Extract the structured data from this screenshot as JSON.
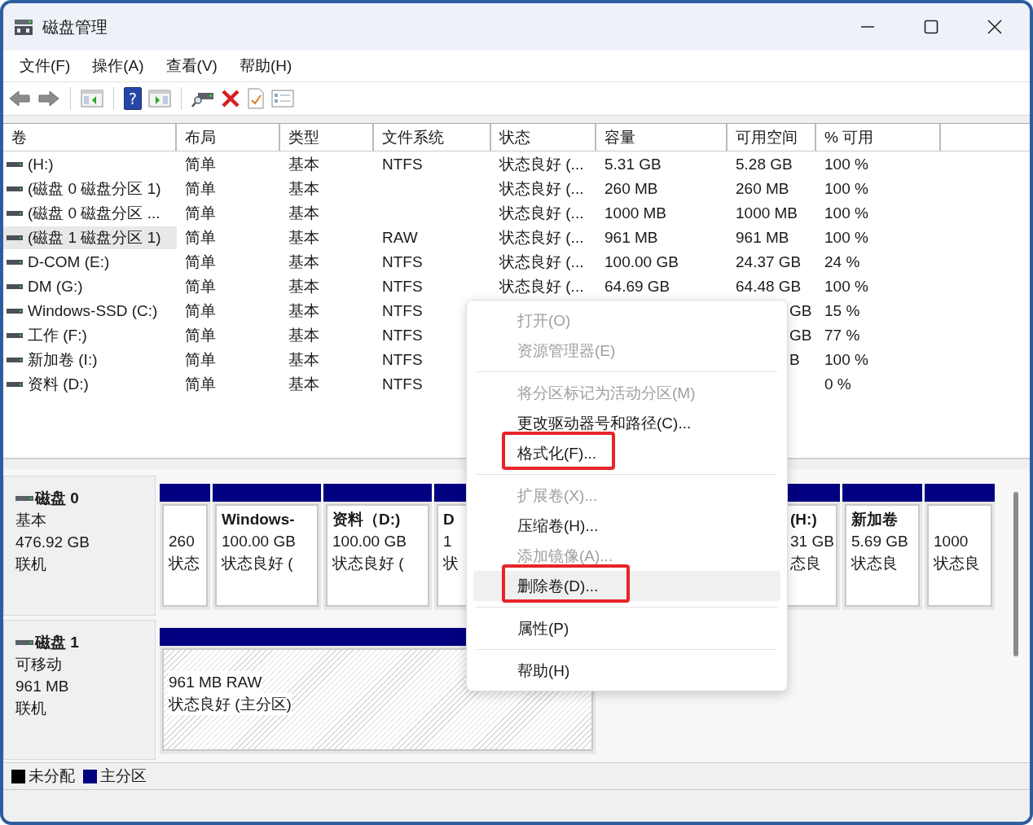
{
  "window": {
    "title": "磁盘管理"
  },
  "menu_bar": [
    "文件(F)",
    "操作(A)",
    "查看(V)",
    "帮助(H)"
  ],
  "toolbar": {
    "help_glyph": "?"
  },
  "table": {
    "columns": [
      "卷",
      "布局",
      "类型",
      "文件系统",
      "状态",
      "容量",
      "可用空间",
      "% 可用"
    ],
    "rows": [
      {
        "selected": false,
        "covered": false,
        "cells": {
          "volume": "(H:)",
          "layout": "简单",
          "type": "基本",
          "fs": "NTFS",
          "status": "状态良好 (...",
          "capacity": "5.31 GB",
          "free": "5.28 GB",
          "pct": "100 %"
        }
      },
      {
        "selected": false,
        "covered": false,
        "cells": {
          "volume": "(磁盘 0 磁盘分区 1)",
          "layout": "简单",
          "type": "基本",
          "status": "状态良好 (...",
          "capacity": "260 MB",
          "free": "260 MB",
          "pct": "100 %"
        }
      },
      {
        "selected": false,
        "covered": false,
        "cells": {
          "volume": "(磁盘 0 磁盘分区 ...",
          "layout": "简单",
          "type": "基本",
          "status": "状态良好 (...",
          "capacity": "1000 MB",
          "free": "1000 MB",
          "pct": "100 %"
        }
      },
      {
        "selected": true,
        "covered": false,
        "cells": {
          "volume": "(磁盘 1 磁盘分区 1)",
          "layout": "简单",
          "type": "基本",
          "fs": "RAW",
          "status": "状态良好 (...",
          "capacity": "961 MB",
          "free": "961 MB",
          "pct": "100 %"
        }
      },
      {
        "selected": false,
        "covered": false,
        "cells": {
          "volume": "D-COM (E:)",
          "layout": "简单",
          "type": "基本",
          "fs": "NTFS",
          "status": "状态良好 (...",
          "capacity": "100.00 GB",
          "free": "24.37 GB",
          "pct": "24 %"
        }
      },
      {
        "selected": false,
        "covered": false,
        "cells": {
          "volume": "DM (G:)",
          "layout": "简单",
          "type": "基本",
          "fs": "NTFS",
          "status": "状态良好 (...",
          "capacity": "64.69 GB",
          "free": "64.48 GB",
          "pct": "100 %"
        }
      },
      {
        "selected": false,
        "covered": true,
        "cells": {
          "volume": "Windows-SSD (C:)",
          "layout": "简单",
          "type": "基本",
          "fs": "NTFS",
          "free": "GB",
          "pct": "15 %"
        }
      },
      {
        "selected": false,
        "covered": true,
        "cells": {
          "volume": "工作 (F:)",
          "layout": "简单",
          "type": "基本",
          "fs": "NTFS",
          "free": "GB",
          "pct": "77 %"
        }
      },
      {
        "selected": false,
        "covered": true,
        "cells": {
          "volume": "新加卷 (I:)",
          "layout": "简单",
          "type": "基本",
          "fs": "NTFS",
          "free": "B",
          "pct": "100 %"
        }
      },
      {
        "selected": false,
        "covered": true,
        "cells": {
          "volume": "资料 (D:)",
          "layout": "简单",
          "type": "基本",
          "fs": "NTFS",
          "pct": "0 %"
        }
      }
    ]
  },
  "disks": [
    {
      "name": "磁盘 0",
      "type": "基本",
      "size": "476.92 GB",
      "state": "联机",
      "partitions": [
        {
          "kind": "primary",
          "covered": false,
          "lines": [
            "260",
            "状态"
          ]
        },
        {
          "kind": "primary",
          "covered": false,
          "title": "Windows-",
          "lines": [
            "100.00 GB",
            "状态良好 ("
          ]
        },
        {
          "kind": "primary",
          "covered": false,
          "title": "资料（D:)",
          "lines": [
            "100.00 GB",
            "状态良好 ("
          ]
        },
        {
          "kind": "primary",
          "covered": false,
          "title": "D",
          "lines": [
            "1",
            "状"
          ]
        },
        {
          "kind": "primary",
          "covered": true,
          "title": "(H:)",
          "lines": [
            "31 GB",
            "态良"
          ]
        },
        {
          "kind": "primary",
          "covered": false,
          "title": "新加卷",
          "lines": [
            "5.69 GB",
            "状态良"
          ]
        },
        {
          "kind": "primary",
          "covered": false,
          "lines": [
            "1000",
            "状态良"
          ]
        }
      ]
    },
    {
      "name": "磁盘 1",
      "type": "可移动",
      "size": "961 MB",
      "state": "联机",
      "partitions": [
        {
          "kind": "raw",
          "covered": false,
          "lines": [
            "961 MB RAW",
            "状态良好 (主分区)"
          ]
        }
      ]
    }
  ],
  "legend": [
    {
      "label": "未分配",
      "color": "#000000"
    },
    {
      "label": "主分区",
      "color": "#000080"
    }
  ],
  "context_menu": {
    "items": [
      {
        "kind": "item",
        "label": "打开(O)",
        "disabled": true,
        "hovered": false,
        "marked": false
      },
      {
        "kind": "item",
        "label": "资源管理器(E)",
        "disabled": true,
        "hovered": false,
        "marked": false
      },
      {
        "kind": "separator"
      },
      {
        "kind": "item",
        "label": "将分区标记为活动分区(M)",
        "disabled": true,
        "hovered": false,
        "marked": false
      },
      {
        "kind": "item",
        "label": "更改驱动器号和路径(C)...",
        "disabled": false,
        "hovered": false,
        "marked": false
      },
      {
        "kind": "item",
        "label": "格式化(F)...",
        "disabled": false,
        "hovered": false,
        "marked": true
      },
      {
        "kind": "separator"
      },
      {
        "kind": "item",
        "label": "扩展卷(X)...",
        "disabled": true,
        "hovered": false,
        "marked": false
      },
      {
        "kind": "item",
        "label": "压缩卷(H)...",
        "disabled": false,
        "hovered": false,
        "marked": false
      },
      {
        "kind": "item",
        "label": "添加镜像(A)...",
        "disabled": true,
        "hovered": false,
        "marked": false
      },
      {
        "kind": "item",
        "label": "删除卷(D)...",
        "disabled": false,
        "hovered": true,
        "marked": true
      },
      {
        "kind": "separator"
      },
      {
        "kind": "item",
        "label": "属性(P)",
        "disabled": false,
        "hovered": false,
        "marked": false
      },
      {
        "kind": "separator"
      },
      {
        "kind": "item",
        "label": "帮助(H)",
        "disabled": false,
        "hovered": false,
        "marked": false
      }
    ]
  }
}
